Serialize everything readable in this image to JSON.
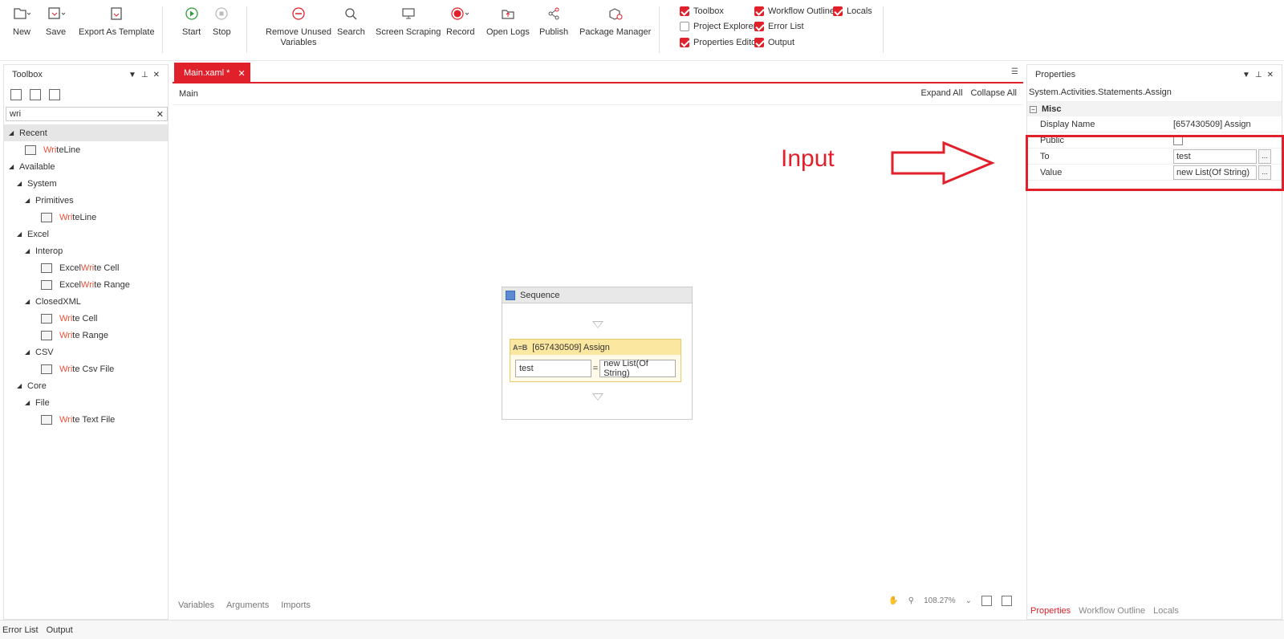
{
  "ribbon": {
    "new": "New",
    "save": "Save",
    "export_template": "Export As Template",
    "start": "Start",
    "stop": "Stop",
    "remove_unused_1": "Remove Unused",
    "remove_unused_2": "Variables",
    "search": "Search",
    "screen_scraping": "Screen Scraping",
    "record": "Record",
    "open_logs": "Open Logs",
    "publish": "Publish",
    "package_manager": "Package Manager",
    "checks": {
      "toolbox": "Toolbox",
      "project_explorer": "Project Explorer",
      "properties_editor": "Properties Editor",
      "workflow_outline": "Workflow Outline",
      "error_list": "Error List",
      "output": "Output",
      "locals": "Locals"
    }
  },
  "toolbox": {
    "title": "Toolbox",
    "search_value": "wri",
    "clear": "✕",
    "recent": "Recent",
    "available": "Available",
    "system": "System",
    "primitives": "Primitives",
    "excel": "Excel",
    "interop": "Interop",
    "closedxml": "ClosedXML",
    "csv": "CSV",
    "core": "Core",
    "file": "File",
    "items": {
      "writeline_recent": {
        "pre": "",
        "hl": "Wri",
        "post": "teLine"
      },
      "writeline": {
        "pre": "",
        "hl": "Wri",
        "post": "teLine"
      },
      "excel_write_cell": {
        "pre": "Excel ",
        "hl": "Wri",
        "post": "te Cell"
      },
      "excel_write_range": {
        "pre": "Excel ",
        "hl": "Wri",
        "post": "te Range"
      },
      "write_cell": {
        "pre": "",
        "hl": "Wri",
        "post": "te Cell"
      },
      "write_range": {
        "pre": "",
        "hl": "Wri",
        "post": "te Range"
      },
      "write_csv": {
        "pre": "",
        "hl": "Wri",
        "post": "te Csv File"
      },
      "write_text": {
        "pre": "",
        "hl": "Wri",
        "post": "te Text File"
      }
    }
  },
  "designer": {
    "tab": "Main.xaml *",
    "tab_close": "✕",
    "breadcrumb": "Main",
    "expand_all": "Expand All",
    "collapse_all": "Collapse All",
    "sequence_title": "Sequence",
    "assign_icon": "A=B",
    "assign_title": "[657430509] Assign",
    "assign_to": "test",
    "assign_eq": "=",
    "assign_value": "new List(Of String)",
    "bottom_tabs": [
      "Variables",
      "Arguments",
      "Imports"
    ],
    "zoom": "108.27%",
    "zoom_caret": "⌄"
  },
  "annotation": {
    "text": "Input",
    "color": "#e0202b"
  },
  "properties": {
    "title": "Properties",
    "type": "System.Activities.Statements.Assign",
    "category": "Misc",
    "rows": {
      "display_name": {
        "name": "Display Name",
        "value": "[657430509] Assign"
      },
      "public": {
        "name": "Public"
      },
      "to": {
        "name": "To",
        "value": "test"
      },
      "value": {
        "name": "Value",
        "value": "new List(Of String)"
      }
    },
    "ellipsis": "...",
    "tabs": [
      "Properties",
      "Workflow Outline",
      "Locals"
    ]
  },
  "status": {
    "error_list": "Error List",
    "output": "Output"
  }
}
